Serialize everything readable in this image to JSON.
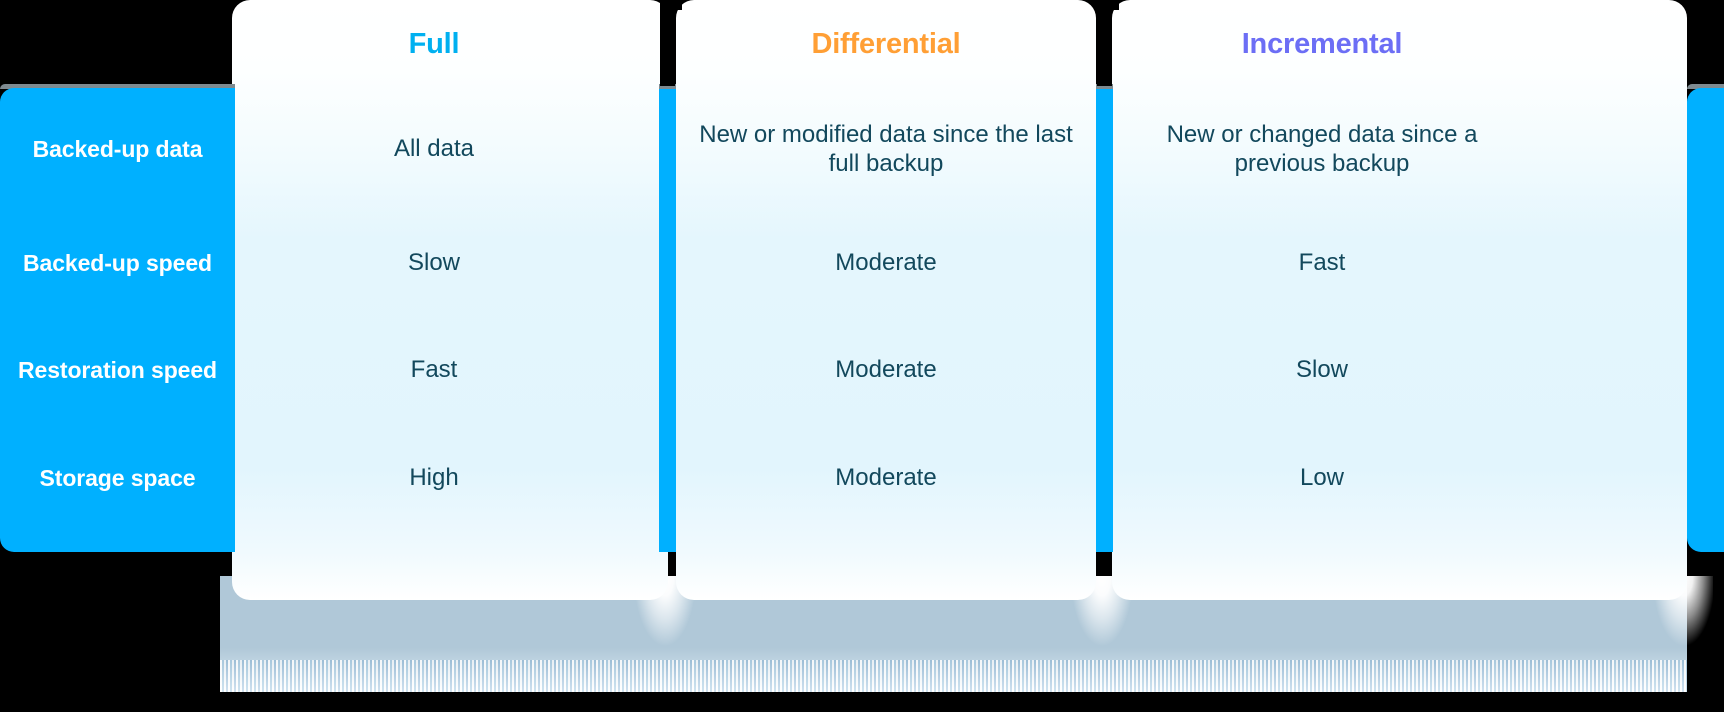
{
  "table": {
    "row_header_column": {
      "rows": [
        {
          "label": "Backed-up data"
        },
        {
          "label": "Backed-up speed"
        },
        {
          "label": "Restoration speed"
        },
        {
          "label": "Storage space"
        }
      ]
    },
    "columns": [
      {
        "header": "Full",
        "header_color": "#00b0f0",
        "cells": [
          "All data",
          "Slow",
          "Fast",
          "High"
        ]
      },
      {
        "header": "Differential",
        "header_color": "#ff9f35",
        "cells": [
          "New or modified data since the last full backup",
          "Moderate",
          "Moderate",
          "Moderate"
        ]
      },
      {
        "header": "Incremental",
        "header_color": "#6c6ef5",
        "cells": [
          "New or changed data since a previous backup",
          "Fast",
          "Slow",
          "Low"
        ]
      }
    ]
  },
  "theme": {
    "accent_blue": "#00b0ff",
    "sidebar_text": "#ffffff",
    "cell_text": "#12485c",
    "card_top": "#ffffff",
    "card_mid": "#e2f5fd",
    "background": "#000000",
    "shadow_band": "#b0c8d8"
  }
}
